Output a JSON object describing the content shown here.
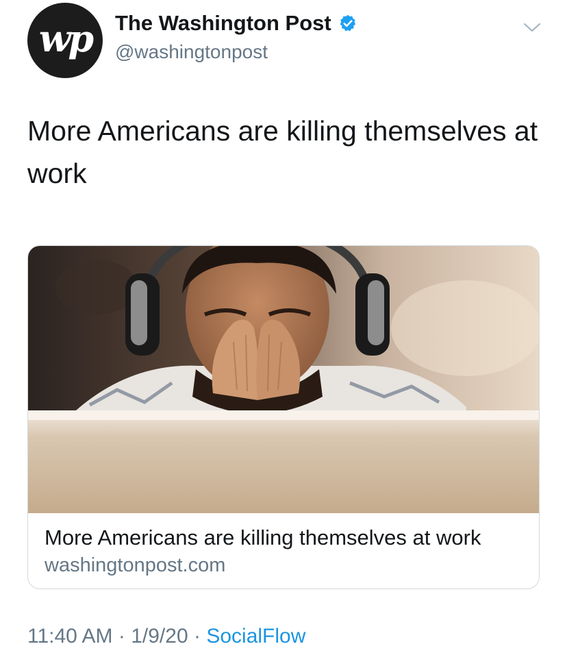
{
  "author": {
    "avatar_text": "wp",
    "display_name": "The Washington Post",
    "handle": "@washingtonpost",
    "verified": true
  },
  "tweet": {
    "text": "More Americans are killing themselves at work"
  },
  "card": {
    "title": "More Americans are killing themselves at work",
    "domain": "washingtonpost.com",
    "image_icon": "man-covering-face-with-headphones"
  },
  "meta": {
    "time": "11:40 AM",
    "separator": "·",
    "date": "1/9/20",
    "source": "SocialFlow"
  },
  "colors": {
    "text": "#14171a",
    "secondary": "#657786",
    "link": "#1b95e0",
    "verified": "#1da1f2"
  }
}
